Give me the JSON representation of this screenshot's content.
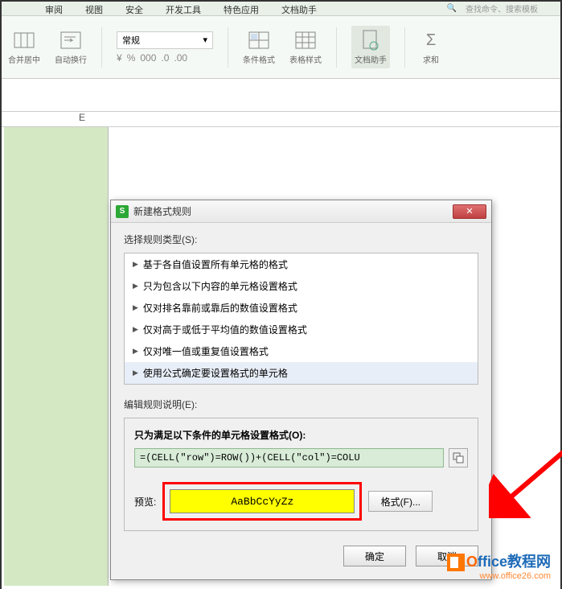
{
  "menu": {
    "tabs": [
      "审阅",
      "视图",
      "安全",
      "开发工具",
      "特色应用",
      "文档助手"
    ],
    "search_icon": "🔍",
    "search_hint": "查找命令、搜索模板"
  },
  "ribbon": {
    "merge": "合并居中",
    "wrap": "自动换行",
    "number_format": "常规",
    "cond_format": "条件格式",
    "table_style": "表格样式",
    "doc_helper": "文档助手",
    "sum": "求和",
    "symbols": {
      "currency": "¥",
      "percent": "%",
      "thousands": "000",
      "dec_inc": ".0←",
      "dec_dec": "→.0"
    }
  },
  "sheet": {
    "col_e": "E"
  },
  "dialog": {
    "title": "新建格式规则",
    "rule_type_label": "选择规则类型(S):",
    "rules": [
      "基于各自值设置所有单元格的格式",
      "只为包含以下内容的单元格设置格式",
      "仅对排名靠前或靠后的数值设置格式",
      "仅对高于或低于平均值的数值设置格式",
      "仅对唯一值或重复值设置格式",
      "使用公式确定要设置格式的单元格"
    ],
    "edit_label": "编辑规则说明(E):",
    "format_for_label": "只为满足以下条件的单元格设置格式(O):",
    "formula": "=(CELL(\"row\")=ROW())+(CELL(\"col\")=COLU",
    "preview_label": "预览:",
    "preview_sample": "AaBbCcYyZz",
    "format_btn": "格式(F)...",
    "ok": "确定",
    "cancel": "取消"
  },
  "watermark": {
    "brand1": "O",
    "brand2": "ffice教程网",
    "url": "www.office26.com"
  }
}
